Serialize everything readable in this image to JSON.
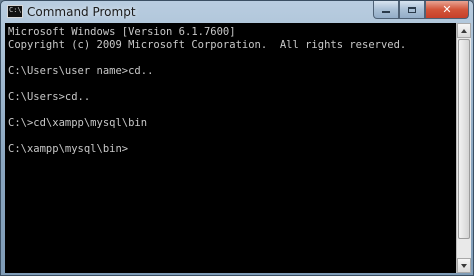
{
  "window": {
    "title": "Command Prompt",
    "app_icon_glyph": "C:\\",
    "controls": {
      "minimize_icon": "minimize-icon",
      "maximize_icon": "maximize-icon",
      "close_glyph": "✕"
    }
  },
  "console": {
    "lines": [
      "Microsoft Windows [Version 6.1.7600]",
      "Copyright (c) 2009 Microsoft Corporation.  All rights reserved.",
      "",
      "C:\\Users\\user name>cd..",
      "",
      "C:\\Users>cd..",
      "",
      "C:\\>cd\\xampp\\mysql\\bin",
      "",
      "C:\\xampp\\mysql\\bin>"
    ]
  },
  "colors": {
    "console_background": "#000000",
    "console_text": "#c8c8c8",
    "close_button": "#c7402a"
  }
}
